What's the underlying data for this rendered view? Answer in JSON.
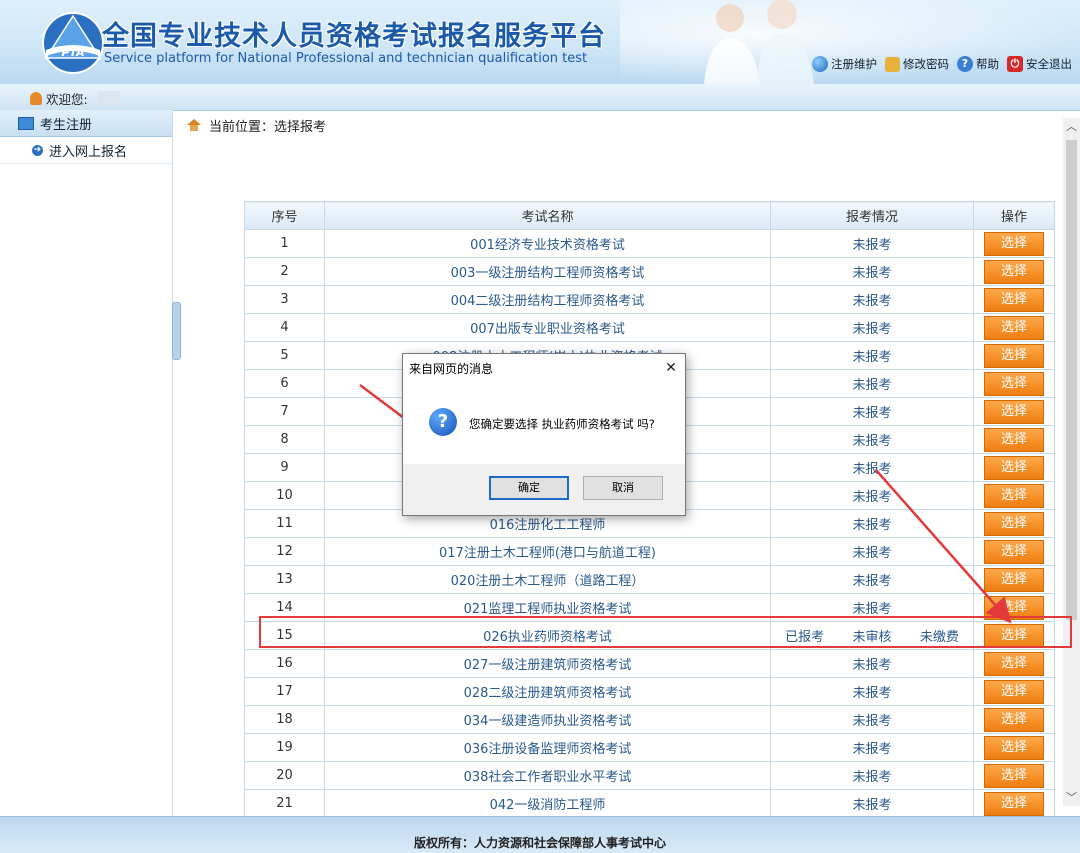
{
  "header": {
    "title_cn": "全国专业技术人员资格考试报名服务平台",
    "title_en": "Service platform for National Professional and technician qualification test",
    "logo_text": "PTA",
    "links": [
      {
        "label": "注册维护",
        "icon": "globe-icon"
      },
      {
        "label": "修改密码",
        "icon": "lock-icon"
      },
      {
        "label": "帮助",
        "icon": "help-icon"
      },
      {
        "label": "安全退出",
        "icon": "exit-icon"
      }
    ]
  },
  "welcome": {
    "label": "欢迎您:"
  },
  "sidebar": {
    "header": "考生注册",
    "items": [
      {
        "label": "进入网上报名"
      }
    ]
  },
  "breadcrumb": {
    "text": "当前位置：选择报考"
  },
  "table": {
    "columns": [
      "序号",
      "考试名称",
      "报考情况",
      "操作"
    ],
    "button_label": "选择",
    "rows": [
      {
        "seq": "1",
        "name": "001经济专业技术资格考试",
        "status": "未报考"
      },
      {
        "seq": "2",
        "name": "003一级注册结构工程师资格考试",
        "status": "未报考"
      },
      {
        "seq": "3",
        "name": "004二级注册结构工程师资格考试",
        "status": "未报考"
      },
      {
        "seq": "4",
        "name": "007出版专业职业资格考试",
        "status": "未报考"
      },
      {
        "seq": "5",
        "name": "008注册土木工程师(岩土)执业资格考试",
        "status": "未报考"
      },
      {
        "seq": "6",
        "name": "",
        "status": "未报考"
      },
      {
        "seq": "7",
        "name": "",
        "status": "未报考"
      },
      {
        "seq": "8",
        "name": "",
        "status": "未报考"
      },
      {
        "seq": "9",
        "name": "",
        "status": "未报考"
      },
      {
        "seq": "10",
        "name": "",
        "status": "未报考"
      },
      {
        "seq": "11",
        "name": "016注册化工工程师",
        "status": "未报考"
      },
      {
        "seq": "12",
        "name": "017注册土木工程师(港口与航道工程)",
        "status": "未报考"
      },
      {
        "seq": "13",
        "name": "020注册土木工程师（道路工程）",
        "status": "未报考"
      },
      {
        "seq": "14",
        "name": "021监理工程师执业资格考试",
        "status": "未报考"
      },
      {
        "seq": "15",
        "name": "026执业药师资格考试",
        "status": "",
        "sub": [
          "已报考",
          "未审核",
          "未缴费"
        ]
      },
      {
        "seq": "16",
        "name": "027一级注册建筑师资格考试",
        "status": "未报考"
      },
      {
        "seq": "17",
        "name": "028二级注册建筑师资格考试",
        "status": "未报考"
      },
      {
        "seq": "18",
        "name": "034一级建造师执业资格考试",
        "status": "未报考"
      },
      {
        "seq": "19",
        "name": "036注册设备监理师资格考试",
        "status": "未报考"
      },
      {
        "seq": "20",
        "name": "038社会工作者职业水平考试",
        "status": "未报考"
      },
      {
        "seq": "21",
        "name": "042一级消防工程师",
        "status": "未报考"
      }
    ]
  },
  "dialog": {
    "title": "来自网页的消息",
    "message": "您确定要选择 执业药师资格考试 吗?",
    "ok_label": "确定",
    "cancel_label": "取消",
    "close_glyph": "✕",
    "icon_glyph": "?"
  },
  "footer": {
    "text": "版权所有：人力资源和社会保障部人事考试中心"
  },
  "colors": {
    "accent": "#1b5aa8",
    "button": "#ee7e10",
    "highlight": "#e23a3a"
  }
}
